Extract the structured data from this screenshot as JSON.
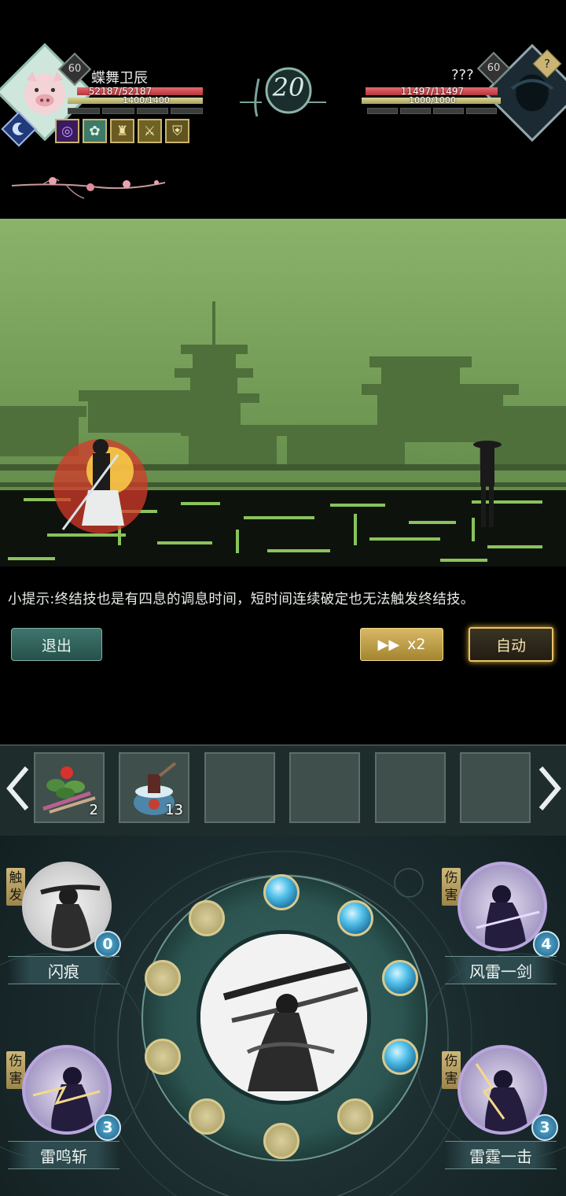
{
  "player": {
    "name": "蝶舞卫辰",
    "level": "60",
    "hp_text": "52187/52187",
    "hp_fraction": 1.0,
    "energy_text": "1400/1400",
    "energy_fraction": 1.0,
    "buffs": [
      "purple-swirl-icon",
      "lotus-icon",
      "figure-icon",
      "sword-icon",
      "shield-icon"
    ]
  },
  "enemy": {
    "name": "???",
    "level": "60",
    "hp_text": "11497/11497",
    "hp_fraction": 1.0,
    "energy_text": "1000/1000",
    "energy_fraction": 1.0,
    "unknown_badge": "?"
  },
  "round": "20",
  "tip": "小提示:终结技也是有四息的调息时间，短时间连续破定也无法触发终结技。",
  "buttons": {
    "exit": "退出",
    "speed": "x2",
    "auto": "自动"
  },
  "items": [
    {
      "icon": "herb-bundle-icon",
      "count": "2"
    },
    {
      "icon": "potion-pot-icon",
      "count": "13"
    },
    {
      "icon": "",
      "count": ""
    },
    {
      "icon": "",
      "count": ""
    },
    {
      "icon": "",
      "count": ""
    },
    {
      "icon": "",
      "count": ""
    }
  ],
  "skills": {
    "top_left": {
      "tag": "触发",
      "name": "闪痕",
      "count": "0"
    },
    "top_right": {
      "tag": "伤害",
      "name": "风雷一剑",
      "count": "4"
    },
    "bottom_left": {
      "tag": "伤害",
      "name": "雷鸣斩",
      "count": "3"
    },
    "bottom_right": {
      "tag": "伤害",
      "name": "雷霆一击",
      "count": "3"
    }
  },
  "colors": {
    "hp": "#c94a50",
    "energy": "#cfc98a",
    "scene_bg": "#8cb26a",
    "auto_glow": "#e9c46a",
    "orb_blue": "#55c3ec"
  }
}
